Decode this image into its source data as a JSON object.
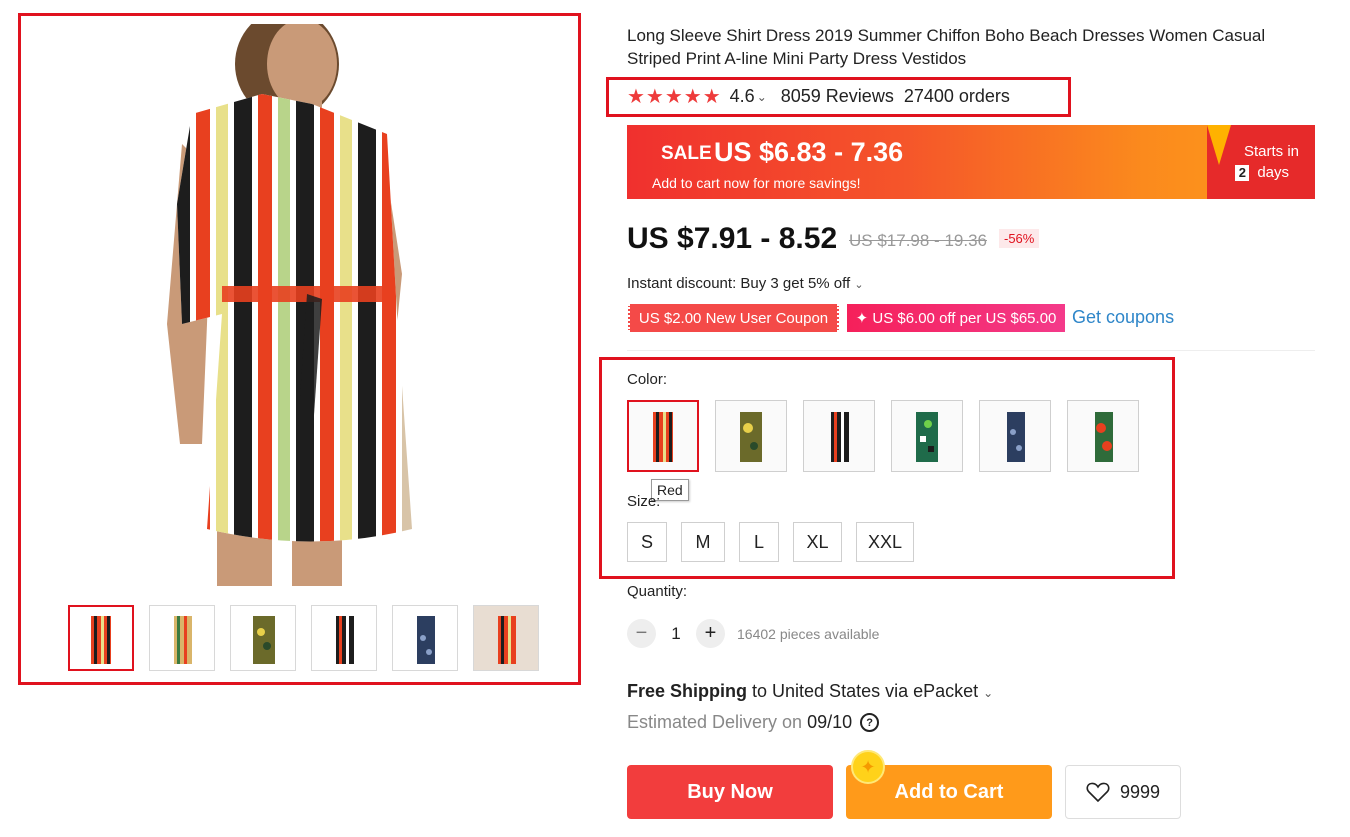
{
  "product": {
    "title": "Long Sleeve Shirt Dress 2019 Summer Chiffon Boho Beach Dresses Women Casual Striped Print A-line Mini Party Dress Vestidos",
    "rating": {
      "stars": 5,
      "score": "4.6",
      "reviews": "8059 Reviews",
      "orders": "27400 orders"
    }
  },
  "sale": {
    "label": "SALE",
    "price": "US $6.83 - 7.36",
    "subtext": "Add to cart now for more savings!",
    "starts_in": "Starts in",
    "days_count": "2",
    "days_label": "days"
  },
  "pricing": {
    "price": "US $7.91 - 8.52",
    "original": "US $17.98 - 19.36",
    "discount": "-56%",
    "instant_discount": "Instant discount: Buy 3 get 5% off"
  },
  "coupons": {
    "new_user": "US $2.00 New User Coupon",
    "store": "✦ US $6.00 off per US $65.00",
    "get_coupons": "Get coupons"
  },
  "options": {
    "color_label": "Color:",
    "selected_color_tooltip": "Red",
    "size_label": "Size:",
    "sizes": [
      "S",
      "M",
      "L",
      "XL",
      "XXL"
    ]
  },
  "quantity": {
    "label": "Quantity:",
    "value": "1",
    "available": "16402 pieces available"
  },
  "shipping": {
    "free": "Free Shipping",
    "destination": " to United States via ePacket",
    "estimated_label": "Estimated Delivery on",
    "date": "09/10"
  },
  "actions": {
    "buy_now": "Buy Now",
    "add_to_cart": "Add to Cart",
    "wishlist_count": "9999"
  },
  "colors": {
    "accent_red": "#e0121e",
    "buy_now": "#f23d3d",
    "add_to_cart": "#ff9a1a",
    "link_blue": "#2e86c9"
  }
}
